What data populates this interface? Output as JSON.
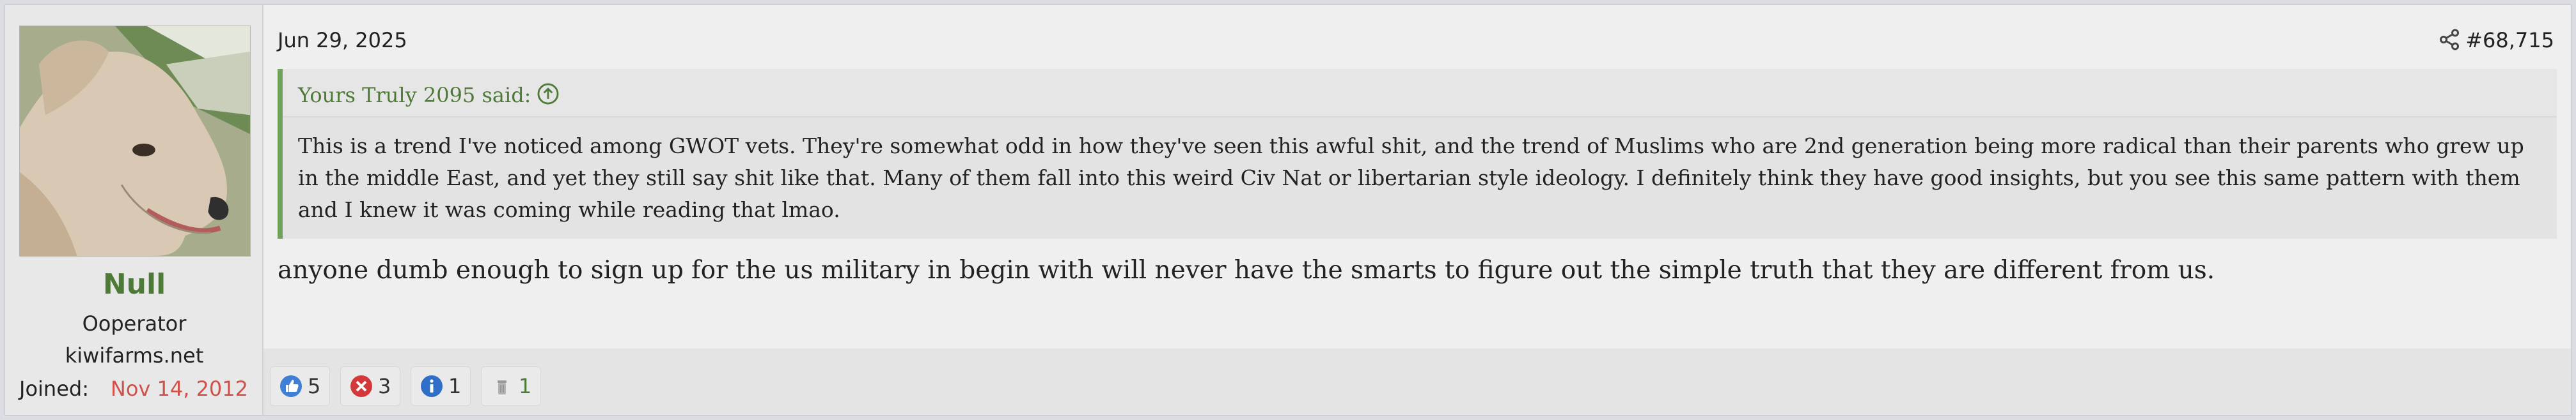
{
  "user": {
    "name": "Null",
    "title": "Ooperator",
    "site": "kiwifarms.net",
    "joined_label": "Joined:",
    "joined_date": "Nov 14, 2012",
    "avatar_icon": "dog-avatar"
  },
  "post": {
    "date": "Jun 29, 2025",
    "number": "#68,715",
    "share_icon": "share-icon"
  },
  "quote": {
    "author": "Yours Truly 2095 said:",
    "jump_icon": "arrow-up-circle-icon",
    "text": "This is a trend I've noticed among GWOT vets. They're somewhat odd in how they've seen this awful shit, and the trend of Muslims who are 2nd generation being more radical than their parents who grew up in the middle East, and yet they still say shit like that. Many of them fall into this weird Civ Nat or libertarian style ideology. I definitely think they have good insights, but you see this same pattern with them and I knew it was coming while reading that lmao."
  },
  "message": "anyone dumb enough to sign up for the us military in begin with will never have the smarts to figure out the simple truth that they are different from us.",
  "reactions": [
    {
      "icon": "thumbs-up-icon",
      "count": "5"
    },
    {
      "icon": "x-circle-icon",
      "count": "3"
    },
    {
      "icon": "info-icon",
      "count": "1"
    },
    {
      "icon": "trash-icon",
      "count": "1"
    }
  ],
  "colors": {
    "accent_green": "#4e7a37",
    "quote_border": "#6ea35a",
    "joined_date": "#d0514b"
  }
}
